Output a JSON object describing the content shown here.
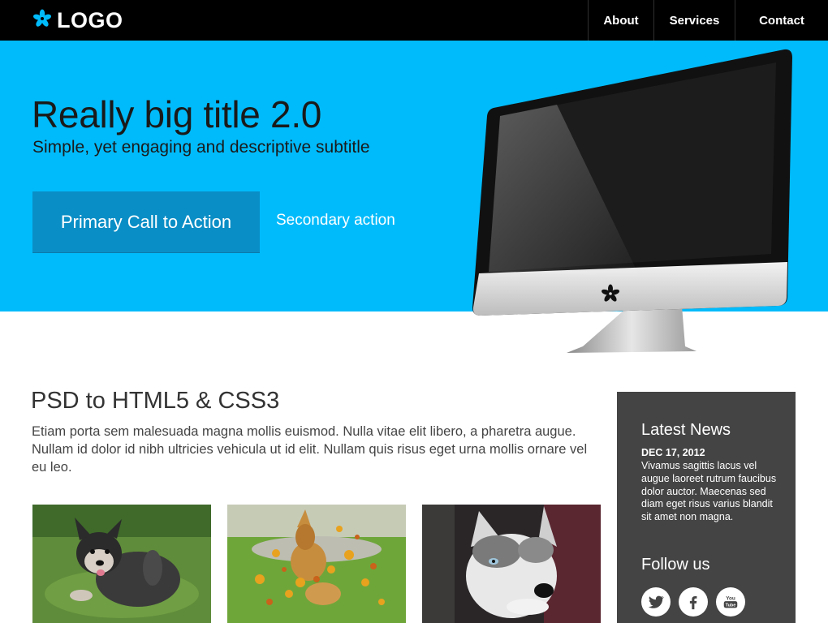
{
  "header": {
    "logo_text": "LOGO",
    "logo_icon": "flower-icon",
    "nav": [
      {
        "label": "About"
      },
      {
        "label": "Services"
      },
      {
        "label": "Contact"
      }
    ]
  },
  "hero": {
    "title": "Really big title 2.0",
    "subtitle": "Simple, yet engaging and descriptive subtitle",
    "primary_cta": "Primary Call to Action",
    "secondary_cta": "Secondary action",
    "background_color": "#00bbfb",
    "primary_button_color": "#0a8ec6"
  },
  "content": {
    "title": "PSD to HTML5 & CSS3",
    "body": "Etiam porta sem malesuada magna mollis euismod. Nulla vitae elit libero, a pharetra augue. Nullam id dolor id nibh ultricies vehicula ut id elit. Nullam quis risus eget urna mollis ornare vel eu leo.",
    "images": [
      {
        "subject": "puppy-on-grass"
      },
      {
        "subject": "dog-jumping-in-leaves"
      },
      {
        "subject": "husky-portrait"
      }
    ]
  },
  "sidebar": {
    "news_title": "Latest News",
    "news_date": "DEC 17, 2012",
    "news_text": "Vivamus sagittis lacus vel augue laoreet rutrum faucibus dolor auctor. Maecenas sed diam eget risus varius blandit sit amet non magna.",
    "follow_title": "Follow us",
    "social": [
      {
        "icon": "twitter-icon"
      },
      {
        "icon": "facebook-icon"
      },
      {
        "icon": "youtube-icon"
      }
    ],
    "background_color": "#444444"
  }
}
